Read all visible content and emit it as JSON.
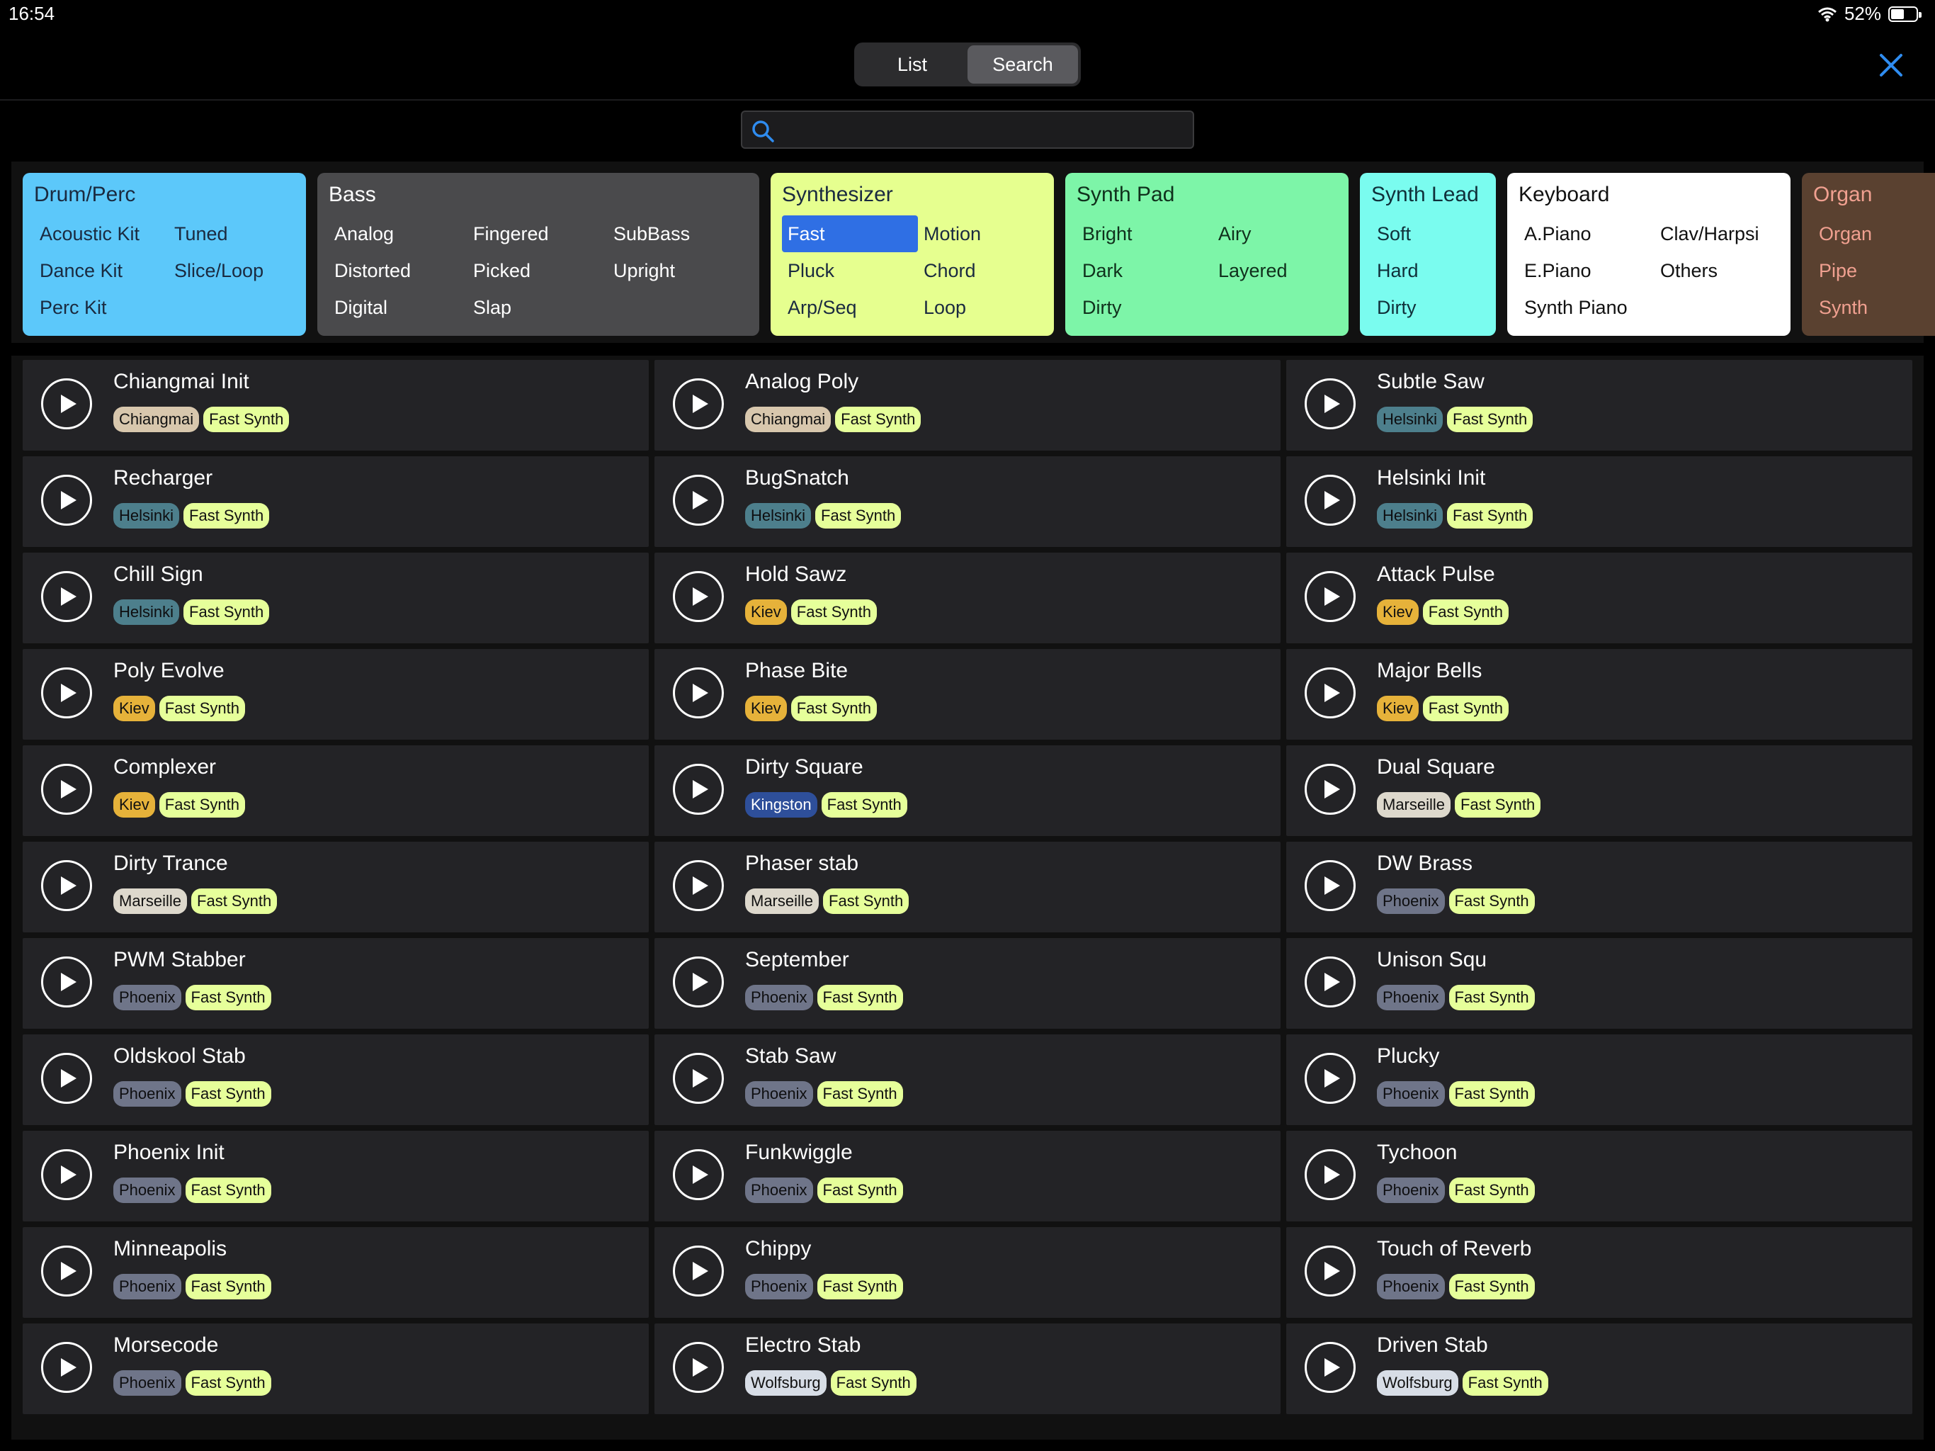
{
  "status": {
    "time": "16:54",
    "battery": "52%",
    "battery_level": 0.52
  },
  "tabs": [
    {
      "label": "List",
      "active": false
    },
    {
      "label": "Search",
      "active": true
    }
  ],
  "search": {
    "value": "",
    "placeholder": ""
  },
  "colors": {
    "accent": "#2f6fe4",
    "tags": {
      "Chiangmai": "#d8c7ad",
      "Helsinki": "#4d7f8c",
      "Kiev": "#e6b23a",
      "Kingston": "#2e4f9a",
      "Marseille": "#ddd8cc",
      "Phoenix": "#6f7589",
      "Wolfsburg": "#d7dde6",
      "Fast Synth": "#e6ff9a"
    }
  },
  "categories": [
    {
      "title": "Drum/Perc",
      "bg": "#5cc8fa",
      "fg": "#1a2a40",
      "cols": 2,
      "items": [
        "Acoustic Kit",
        "Tuned",
        "Dance Kit",
        "Slice/Loop",
        "Perc Kit"
      ]
    },
    {
      "title": "Bass",
      "bg": "#4a4a4c",
      "fg": "#ffffff",
      "cols": 3,
      "items": [
        "Analog",
        "Fingered",
        "SubBass",
        "Distorted",
        "Picked",
        "Upright",
        "Digital",
        "Slap"
      ]
    },
    {
      "title": "Synthesizer",
      "bg": "#e6ff8f",
      "fg": "#1a2a40",
      "cols": 2,
      "selected": "Fast",
      "items": [
        "Fast",
        "Motion",
        "Pluck",
        "Chord",
        "Arp/Seq",
        "Loop"
      ]
    },
    {
      "title": "Synth Pad",
      "bg": "#7df5a8",
      "fg": "#10301c",
      "cols": 2,
      "items": [
        "Bright",
        "Airy",
        "Dark",
        "Layered",
        "Dirty"
      ]
    },
    {
      "title": "Synth Lead",
      "bg": "#7afcef",
      "fg": "#10303a",
      "cols": 1,
      "items": [
        "Soft",
        "Hard",
        "Dirty"
      ]
    },
    {
      "title": "Keyboard",
      "bg": "#ffffff",
      "fg": "#111111",
      "cols": 2,
      "items": [
        "A.Piano",
        "Clav/Harpsi",
        "E.Piano",
        "Others",
        "Synth Piano"
      ]
    },
    {
      "title": "Organ",
      "bg": "#5a4130",
      "fg": "#f0a090",
      "cols": 1,
      "items": [
        "Organ",
        "Pipe",
        "Synth"
      ]
    }
  ],
  "presets": [
    [
      {
        "name": "Chiangmai Init",
        "tags": [
          "Chiangmai",
          "Fast Synth"
        ]
      },
      {
        "name": "Recharger",
        "tags": [
          "Helsinki",
          "Fast Synth"
        ]
      },
      {
        "name": "Chill Sign",
        "tags": [
          "Helsinki",
          "Fast Synth"
        ]
      },
      {
        "name": "Poly Evolve",
        "tags": [
          "Kiev",
          "Fast Synth"
        ]
      },
      {
        "name": "Complexer",
        "tags": [
          "Kiev",
          "Fast Synth"
        ]
      },
      {
        "name": "Dirty Trance",
        "tags": [
          "Marseille",
          "Fast Synth"
        ]
      },
      {
        "name": "PWM Stabber",
        "tags": [
          "Phoenix",
          "Fast Synth"
        ]
      },
      {
        "name": "Oldskool Stab",
        "tags": [
          "Phoenix",
          "Fast Synth"
        ]
      },
      {
        "name": "Phoenix Init",
        "tags": [
          "Phoenix",
          "Fast Synth"
        ]
      },
      {
        "name": "Minneapolis",
        "tags": [
          "Phoenix",
          "Fast Synth"
        ]
      },
      {
        "name": "Morsecode",
        "tags": [
          "Phoenix",
          "Fast Synth"
        ]
      }
    ],
    [
      {
        "name": "Analog Poly",
        "tags": [
          "Chiangmai",
          "Fast Synth"
        ]
      },
      {
        "name": "BugSnatch",
        "tags": [
          "Helsinki",
          "Fast Synth"
        ]
      },
      {
        "name": "Hold Sawz",
        "tags": [
          "Kiev",
          "Fast Synth"
        ]
      },
      {
        "name": "Phase Bite",
        "tags": [
          "Kiev",
          "Fast Synth"
        ]
      },
      {
        "name": "Dirty Square",
        "tags": [
          "Kingston",
          "Fast Synth"
        ]
      },
      {
        "name": "Phaser stab",
        "tags": [
          "Marseille",
          "Fast Synth"
        ]
      },
      {
        "name": "September",
        "tags": [
          "Phoenix",
          "Fast Synth"
        ]
      },
      {
        "name": "Stab Saw",
        "tags": [
          "Phoenix",
          "Fast Synth"
        ]
      },
      {
        "name": "Funkwiggle",
        "tags": [
          "Phoenix",
          "Fast Synth"
        ]
      },
      {
        "name": "Chippy",
        "tags": [
          "Phoenix",
          "Fast Synth"
        ]
      },
      {
        "name": "Electro Stab",
        "tags": [
          "Wolfsburg",
          "Fast Synth"
        ]
      }
    ],
    [
      {
        "name": "Subtle Saw",
        "tags": [
          "Helsinki",
          "Fast Synth"
        ]
      },
      {
        "name": "Helsinki Init",
        "tags": [
          "Helsinki",
          "Fast Synth"
        ]
      },
      {
        "name": "Attack Pulse",
        "tags": [
          "Kiev",
          "Fast Synth"
        ]
      },
      {
        "name": "Major Bells",
        "tags": [
          "Kiev",
          "Fast Synth"
        ]
      },
      {
        "name": "Dual Square",
        "tags": [
          "Marseille",
          "Fast Synth"
        ]
      },
      {
        "name": "DW Brass",
        "tags": [
          "Phoenix",
          "Fast Synth"
        ]
      },
      {
        "name": "Unison Squ",
        "tags": [
          "Phoenix",
          "Fast Synth"
        ]
      },
      {
        "name": "Plucky",
        "tags": [
          "Phoenix",
          "Fast Synth"
        ]
      },
      {
        "name": "Tychoon",
        "tags": [
          "Phoenix",
          "Fast Synth"
        ]
      },
      {
        "name": "Touch of Reverb",
        "tags": [
          "Phoenix",
          "Fast Synth"
        ]
      },
      {
        "name": "Driven Stab",
        "tags": [
          "Wolfsburg",
          "Fast Synth"
        ]
      }
    ]
  ]
}
